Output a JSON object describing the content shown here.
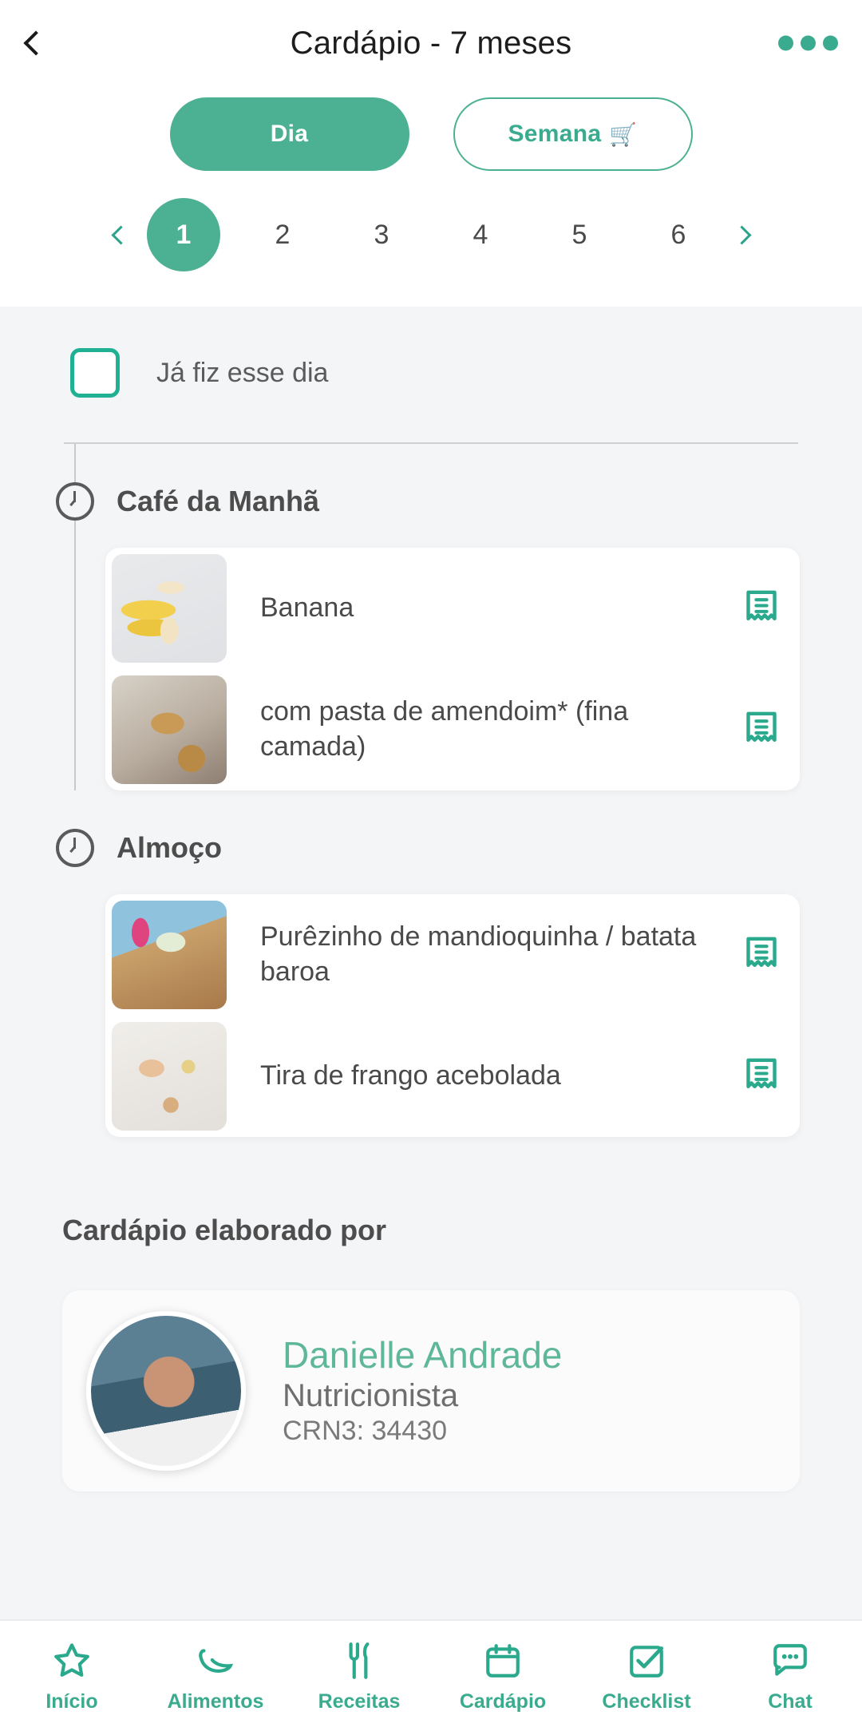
{
  "header": {
    "title": "Cardápio - 7 meses",
    "back_icon": "chevron-left-icon",
    "menu_icon": "more-options-icon"
  },
  "view_toggle": {
    "day_label": "Dia",
    "week_label": "Semana",
    "week_icon": "🛒",
    "active": "Dia"
  },
  "day_pager": {
    "prev_icon": "chevron-left-icon",
    "next_icon": "chevron-right-icon",
    "days": [
      "1",
      "2",
      "3",
      "4",
      "5",
      "6"
    ],
    "selected": "1"
  },
  "done_checkbox": {
    "label": "Já fiz esse dia",
    "checked": false
  },
  "meals": [
    {
      "title": "Café da Manhã",
      "icon": "clock-icon",
      "items": [
        {
          "name": "Banana",
          "thumb": "banana",
          "recipe_icon": "recipe-receipt-icon"
        },
        {
          "name": "com pasta de amendoim* (fina camada)",
          "thumb": "peanut",
          "recipe_icon": "recipe-receipt-icon"
        }
      ]
    },
    {
      "title": "Almoço",
      "icon": "clock-icon",
      "items": [
        {
          "name": "Purêzinho de mandioquinha / batata baroa",
          "thumb": "pure",
          "recipe_icon": "recipe-receipt-icon"
        },
        {
          "name": "Tira de frango acebolada",
          "thumb": "frango",
          "recipe_icon": "recipe-receipt-icon"
        }
      ]
    }
  ],
  "nutritionist": {
    "section_title": "Cardápio elaborado por",
    "name": "Danielle Andrade",
    "role": "Nutricionista",
    "registry": "CRN3: 34430"
  },
  "bottom_nav": [
    {
      "label": "Início",
      "icon": "star-icon"
    },
    {
      "label": "Alimentos",
      "icon": "banana-icon"
    },
    {
      "label": "Receitas",
      "icon": "utensils-icon"
    },
    {
      "label": "Cardápio",
      "icon": "calendar-icon"
    },
    {
      "label": "Checklist",
      "icon": "check-square-icon"
    },
    {
      "label": "Chat",
      "icon": "chat-bubble-icon"
    }
  ],
  "colors": {
    "brand_green": "#3aab8e",
    "accent_green": "#4cb093",
    "page_bg": "#f4f5f7",
    "text_dark": "#4a4a4a"
  }
}
